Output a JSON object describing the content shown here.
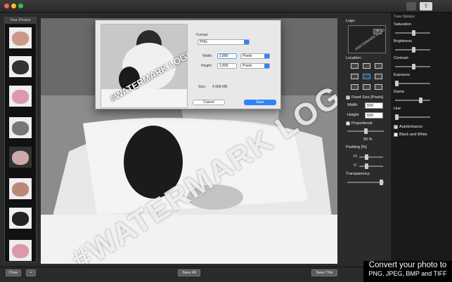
{
  "sidebar": {
    "title": "Your Photos"
  },
  "toolbar": {
    "share_icon": "share-icon",
    "print_icon": "printer-icon"
  },
  "bottom": {
    "clear": "Clear",
    "add": "+",
    "save_all": "Save All",
    "save_this": "Save This"
  },
  "watermark": {
    "text": "#WATERMARK LOGO"
  },
  "dialog": {
    "format_label": "Format:",
    "format_value": "PNG",
    "width_label": "Width:",
    "width_value": "2,880",
    "height_label": "Height:",
    "height_value": "1,800",
    "unit": "Pixels",
    "size_label": "Size:",
    "size_value": "4.968 MB",
    "cancel": "Cancel",
    "save": "Save",
    "preview_text": "#WATERMARK LOGO"
  },
  "panel": {
    "logo_label": "Logo:",
    "logo_preview_text": "#WATERMARK LOGO",
    "add_logo": "+",
    "location_label": "Location:",
    "fixed_size_label": "Fixed Size [Pixels]",
    "width_label": "Width:",
    "width_value": "500",
    "height_label": "Height:",
    "height_value": "500",
    "proportional_label": "Proportional",
    "percent": "50 %",
    "padding_label": "Padding [%]",
    "padding_h": "H:",
    "padding_v": "V:",
    "transparency_label": "Transparency:"
  },
  "tune": {
    "title": "Tune Options",
    "saturation": "Saturation",
    "brightness": "Brightness",
    "contrast": "Contrast",
    "exposure": "Exposure",
    "gama": "Gama",
    "hue": "Hue",
    "autoenhance": "AutoEnhance",
    "blackwhite": "Black and White"
  },
  "caption": {
    "line1": "Convert your photo to",
    "line2": "PNG, JPEG, BMP and TIFF"
  }
}
